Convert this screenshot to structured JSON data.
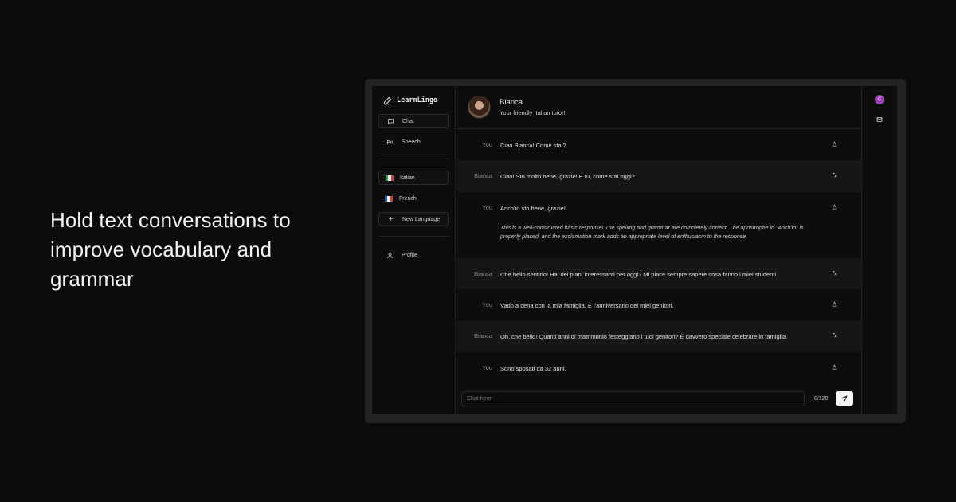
{
  "headline": "Hold text conversations to improve vocabulary and grammar",
  "app": {
    "logo": "LearnLingo",
    "nav": [
      {
        "label": "Chat",
        "icon": "message-square-icon",
        "active": true
      },
      {
        "label": "Speech",
        "icon": "audio-icon",
        "active": false
      }
    ],
    "languages": [
      {
        "label": "Italian",
        "colors": [
          "#2e9c47",
          "#f3f3f3",
          "#d43a37"
        ]
      },
      {
        "label": "French",
        "colors": [
          "#1f4fae",
          "#f3f3f3",
          "#d43a37"
        ]
      }
    ],
    "new_language_label": "New Language",
    "profile_label": "Profile"
  },
  "tutor": {
    "name": "Bianca",
    "subtitle": "Your friendly Italian tutor!"
  },
  "messages": [
    {
      "sender": "You",
      "text": "Ciao Bianca! Come stai?",
      "icon": "spell-check-icon"
    },
    {
      "sender": "Bianca",
      "text": "Ciao! Sto molto bene, grazie! E tu, come stai oggi?",
      "icon": "translate-icon"
    },
    {
      "sender": "You",
      "text": "Anch'io sto bene, grazie!",
      "icon": "spell-check-icon",
      "feedback": "This is a well-constructed basic response! The spelling and grammar are completely correct. The apostrophe in \"Anch'io\" is properly placed, and the exclamation mark adds an appropriate level of enthusiasm to the response."
    },
    {
      "sender": "Bianca",
      "text": "Che bello sentirlo! Hai dei piani interessanti per oggi? Mi piace sempre sapere cosa fanno i miei studenti.",
      "icon": "translate-icon"
    },
    {
      "sender": "You",
      "text": "Vado a cena con la mia famiglia. È l'anniversario dei miei genitori.",
      "icon": "spell-check-icon"
    },
    {
      "sender": "Bianca",
      "text": "Oh, che bello! Quanti anni di matrimonio festeggiano i tuoi genitori? È davvero speciale celebrare in famiglia.",
      "icon": "translate-icon"
    },
    {
      "sender": "You",
      "text": "Sono sposati da 32 anni.",
      "icon": "spell-check-icon"
    }
  ],
  "composer": {
    "placeholder": "Chat here!",
    "value": "",
    "counter": "0/120"
  },
  "rail": {
    "user_initial": "C",
    "user_color": "#9b3fb4"
  }
}
